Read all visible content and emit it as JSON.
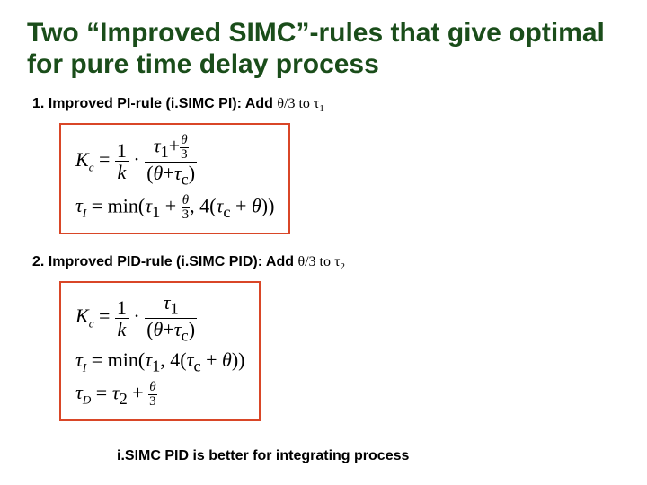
{
  "title": "Two “Improved SIMC”-rules that give optimal for pure time delay process",
  "rule1": {
    "head_prefix": "1. Improved PI-rule (i.SIMC PI): Add ",
    "head_frac": "θ/3",
    "head_mid": " to ",
    "head_tau": "τ",
    "head_sub": "1",
    "Kc_lhs": "K",
    "Kc_sub": "c",
    "tauI_lhs": "τ",
    "tauI_sub": "I"
  },
  "rule2": {
    "head_prefix": "2. Improved PID-rule (i.SIMC PID): Add ",
    "head_frac": "θ/3",
    "head_mid": " to ",
    "head_tau": "τ",
    "head_sub": "2",
    "Kc_lhs": "K",
    "Kc_sub": "c",
    "tauI_lhs": "τ",
    "tauI_sub": "I",
    "tauD_lhs": "τ",
    "tauD_sub": "D"
  },
  "note": "i.SIMC PID is better for integrating process",
  "sym": {
    "eq": " = ",
    "one": "1",
    "k": "k",
    "dot": " · ",
    "tau1": "τ",
    "s1": "1",
    "tau2": "τ",
    "s2": "2",
    "plus": "+",
    "theta": "θ",
    "three": "3",
    "lp": "(",
    "rp": ")",
    "tauc": "τ",
    "sc": "c",
    "min": "min",
    "comma": ", ",
    "four": "4"
  }
}
